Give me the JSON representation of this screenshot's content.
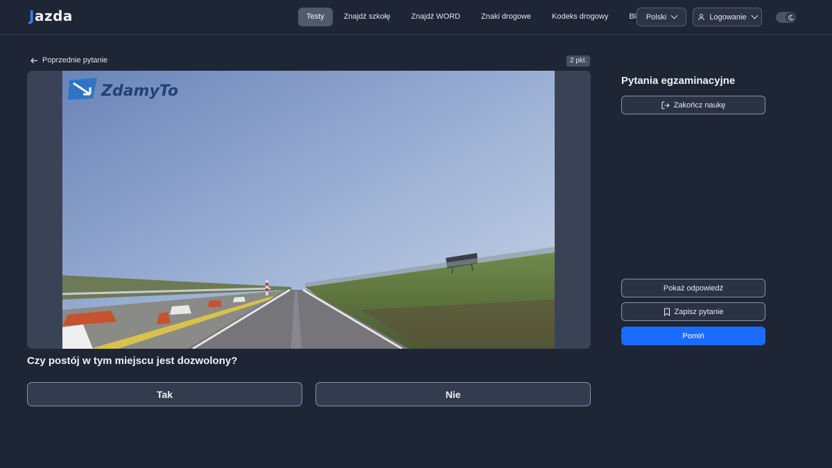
{
  "header": {
    "logo_mark": "J",
    "logo_text": "azda",
    "nav": [
      {
        "label": "Testy",
        "active": true
      },
      {
        "label": "Znajdź szkołę"
      },
      {
        "label": "Znajdź WORD"
      },
      {
        "label": "Znaki drogowe"
      },
      {
        "label": "Kodeks drogowy"
      },
      {
        "label": "Blog"
      }
    ],
    "language_label": "Polski",
    "login_label": "Logowanie",
    "theme_toggle_icon": "moon-icon"
  },
  "question": {
    "back_label": "Poprzednie pytanie",
    "points_label": "2 pkt.",
    "media_watermark": "ZdamyTo",
    "text": "Czy postój w tym miejscu jest dozwolony?",
    "answers": [
      "Tak",
      "Nie"
    ]
  },
  "sidebar": {
    "title": "Pytania egzaminacyjne",
    "finish_label": "Zakończ naukę",
    "show_answer_label": "Pokaż odpowiedź",
    "save_label": "Zapisz pytanie",
    "skip_label": "Pomiń"
  },
  "colors": {
    "background": "#1e2535",
    "accent": "#1a6cff",
    "logo_accent": "#3d7bff"
  }
}
